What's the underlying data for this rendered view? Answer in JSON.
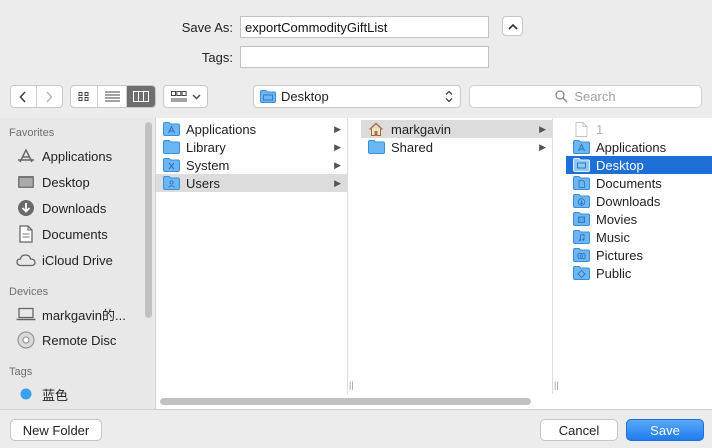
{
  "form": {
    "save_as_label": "Save As:",
    "save_as_value": "exportCommodityGiftList",
    "tags_label": "Tags:",
    "tags_value": ""
  },
  "toolbar": {
    "back_icon": "chevron-left-icon",
    "forward_icon": "chevron-right-icon",
    "view_modes": [
      "icon-view",
      "list-view",
      "column-view"
    ],
    "active_view": "column-view",
    "arrange_icon": "arrange-grid-icon",
    "location": "Desktop",
    "search_placeholder": "Search"
  },
  "sidebar": {
    "favorites_heading": "Favorites",
    "favorites": [
      {
        "label": "Applications",
        "icon": "applications-icon"
      },
      {
        "label": "Desktop",
        "icon": "desktop-icon"
      },
      {
        "label": "Downloads",
        "icon": "downloads-icon"
      },
      {
        "label": "Documents",
        "icon": "documents-icon"
      },
      {
        "label": "iCloud Drive",
        "icon": "cloud-icon"
      }
    ],
    "devices_heading": "Devices",
    "devices": [
      {
        "label": "markgavin的...",
        "icon": "laptop-icon"
      },
      {
        "label": "Remote Disc",
        "icon": "disc-icon"
      }
    ],
    "tags_heading": "Tags",
    "tags": [
      {
        "label": "蓝色",
        "color": "#3aa0f2"
      }
    ]
  },
  "columns": [
    {
      "items": [
        {
          "label": "Applications",
          "icon": "folder-applications-icon",
          "has_children": true
        },
        {
          "label": "Library",
          "icon": "folder-icon",
          "has_children": true
        },
        {
          "label": "System",
          "icon": "folder-system-icon",
          "has_children": true
        },
        {
          "label": "Users",
          "icon": "folder-users-icon",
          "has_children": true,
          "selected": "grey"
        }
      ]
    },
    {
      "items": [
        {
          "label": "markgavin",
          "icon": "home-icon",
          "has_children": true,
          "selected": "grey"
        },
        {
          "label": "Shared",
          "icon": "folder-icon",
          "has_children": true
        }
      ]
    },
    {
      "items": [
        {
          "label": "1",
          "icon": "document-icon",
          "dimmed": true
        },
        {
          "label": "Applications",
          "icon": "folder-applications-icon"
        },
        {
          "label": "Desktop",
          "icon": "folder-desktop-icon",
          "selected": "blue"
        },
        {
          "label": "Documents",
          "icon": "folder-documents-icon"
        },
        {
          "label": "Downloads",
          "icon": "folder-downloads-icon"
        },
        {
          "label": "Movies",
          "icon": "folder-movies-icon"
        },
        {
          "label": "Music",
          "icon": "folder-music-icon"
        },
        {
          "label": "Pictures",
          "icon": "folder-pictures-icon"
        },
        {
          "label": "Public",
          "icon": "folder-public-icon"
        }
      ]
    }
  ],
  "footer": {
    "new_folder": "New Folder",
    "cancel": "Cancel",
    "save": "Save"
  },
  "colors": {
    "selection_blue": "#1e6fd8",
    "folder_blue": "#5eaef0",
    "accent_button": "#1f7cf0"
  }
}
